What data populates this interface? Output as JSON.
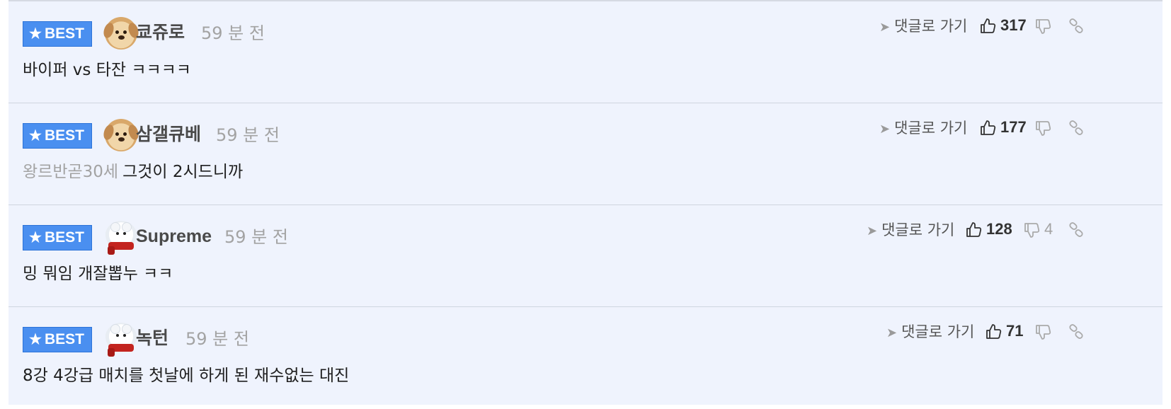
{
  "badge_label": "BEST",
  "goto_label": "댓글로 가기",
  "comments": [
    {
      "username": "쿄쥬로",
      "time": "59 분 전",
      "avatar": "puppy-avatar",
      "mention": "",
      "text": "바이퍼 vs 타잔 ㅋㅋㅋㅋ",
      "upvotes": "317",
      "downvotes": ""
    },
    {
      "username": "삼갤큐베",
      "time": "59 분 전",
      "avatar": "puppy-avatar",
      "mention": "왕르반곧30세",
      "text": "그것이 2시드니까",
      "upvotes": "177",
      "downvotes": ""
    },
    {
      "username": "Supreme",
      "time": "59 분 전",
      "avatar": "polar-bear-avatar",
      "mention": "",
      "text": "밍 뭐임 개잘뽑누 ㅋㅋ",
      "upvotes": "128",
      "downvotes": "4"
    },
    {
      "username": "녹턴",
      "time": "59 분 전",
      "avatar": "polar-bear-avatar",
      "mention": "",
      "text": "8강 4강급 매치를 첫날에 하게 된 재수없는 대진",
      "upvotes": "71",
      "downvotes": ""
    }
  ],
  "colors": {
    "badge_bg": "#4a8ff0",
    "row_bg": "#eff3fd",
    "muted_text": "#a3a3a3"
  }
}
